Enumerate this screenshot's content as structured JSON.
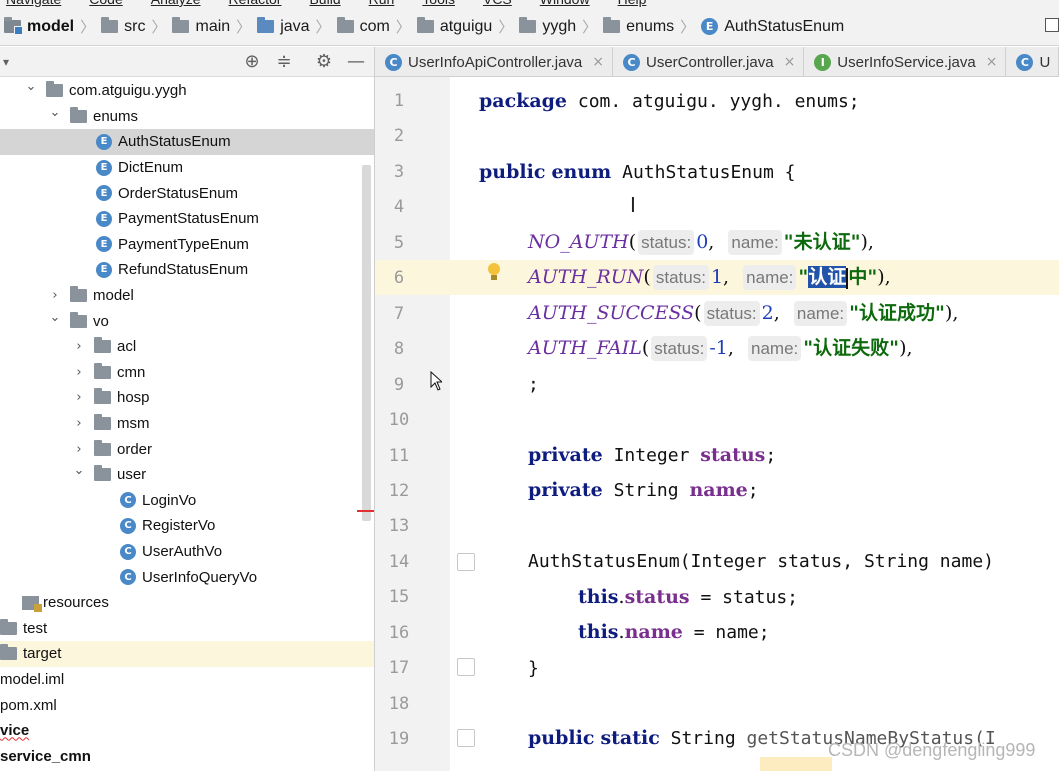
{
  "menu": [
    "Navigate",
    "Code",
    "Analyze",
    "Refactor",
    "Build",
    "Run",
    "Tools",
    "VCS",
    "Window",
    "Help"
  ],
  "breadcrumb": [
    "model",
    "src",
    "main",
    "java",
    "com",
    "atguigu",
    "yygh",
    "enums",
    "AuthStatusEnum"
  ],
  "tabs": [
    {
      "label": "UserInfoApiController.java",
      "icon": "class-icon"
    },
    {
      "label": "UserController.java",
      "icon": "class-icon"
    },
    {
      "label": "UserInfoService.java",
      "icon": "interface-icon"
    },
    {
      "label": "U",
      "icon": "class-icon"
    }
  ],
  "tree": [
    {
      "label": "com.atguigu.yygh",
      "kind": "package",
      "expanded": true
    },
    {
      "label": "enums",
      "kind": "package",
      "expanded": true
    },
    {
      "label": "AuthStatusEnum",
      "kind": "enum",
      "selected": true
    },
    {
      "label": "DictEnum",
      "kind": "enum"
    },
    {
      "label": "OrderStatusEnum",
      "kind": "enum"
    },
    {
      "label": "PaymentStatusEnum",
      "kind": "enum"
    },
    {
      "label": "PaymentTypeEnum",
      "kind": "enum"
    },
    {
      "label": "RefundStatusEnum",
      "kind": "enum"
    },
    {
      "label": "model",
      "kind": "package",
      "expanded": false
    },
    {
      "label": "vo",
      "kind": "package",
      "expanded": true
    },
    {
      "label": "acl",
      "kind": "package",
      "expanded": false
    },
    {
      "label": "cmn",
      "kind": "package",
      "expanded": false
    },
    {
      "label": "hosp",
      "kind": "package",
      "expanded": false
    },
    {
      "label": "msm",
      "kind": "package",
      "expanded": false
    },
    {
      "label": "order",
      "kind": "package",
      "expanded": false
    },
    {
      "label": "user",
      "kind": "package",
      "expanded": true
    },
    {
      "label": "LoginVo",
      "kind": "class"
    },
    {
      "label": "RegisterVo",
      "kind": "class"
    },
    {
      "label": "UserAuthVo",
      "kind": "class"
    },
    {
      "label": "UserInfoQueryVo",
      "kind": "class"
    },
    {
      "label": "resources",
      "kind": "resources"
    },
    {
      "label": "test",
      "kind": "folder"
    },
    {
      "label": "target",
      "kind": "folder"
    },
    {
      "label": "model.iml",
      "kind": "file"
    },
    {
      "label": "pom.xml",
      "kind": "file"
    },
    {
      "label": "vice",
      "kind": "module"
    },
    {
      "label": "service_cmn",
      "kind": "module"
    }
  ],
  "code": {
    "line_numbers": [
      "1",
      "2",
      "3",
      "4",
      "5",
      "6",
      "7",
      "8",
      "9",
      "10",
      "11",
      "12",
      "13",
      "14",
      "15",
      "16",
      "17",
      "18",
      "19"
    ],
    "package_kw": "package",
    "package_name": " com. atguigu. yygh. enums;",
    "public_kw": "public",
    "enum_kw": "enum",
    "class_decl": " AuthStatusEnum {",
    "hint_status": "status:",
    "hint_name": "name:",
    "c1": "NO_AUTH",
    "c1_status": "0",
    "c1_name": "\"未认证\"",
    "c2": "AUTH_RUN",
    "c2_status": "1",
    "c2_name_open": "\"",
    "c2_name_sel": "认证",
    "c2_name_rest": "中\"",
    "c3": "AUTH_SUCCESS",
    "c3_status": "2",
    "c3_name": "\"认证成功\"",
    "c4": "AUTH_FAIL",
    "c4_status": "-1",
    "c4_name": "\"认证失败\"",
    "semicolon": ";",
    "private_kw": "private",
    "type_integer": " Integer ",
    "field_status": "status",
    "type_string": " String ",
    "field_name": "name",
    "ctor": "AuthStatusEnum(Integer status, String name)",
    "this_kw": "this",
    "assign_status": " = status;",
    "assign_name": " = name;",
    "close_brace": "}",
    "static_kw": "static",
    "string_type": " String ",
    "method_name": "getStatusNameByStatus(I"
  },
  "watermark": "CSDN @dengfengling999"
}
